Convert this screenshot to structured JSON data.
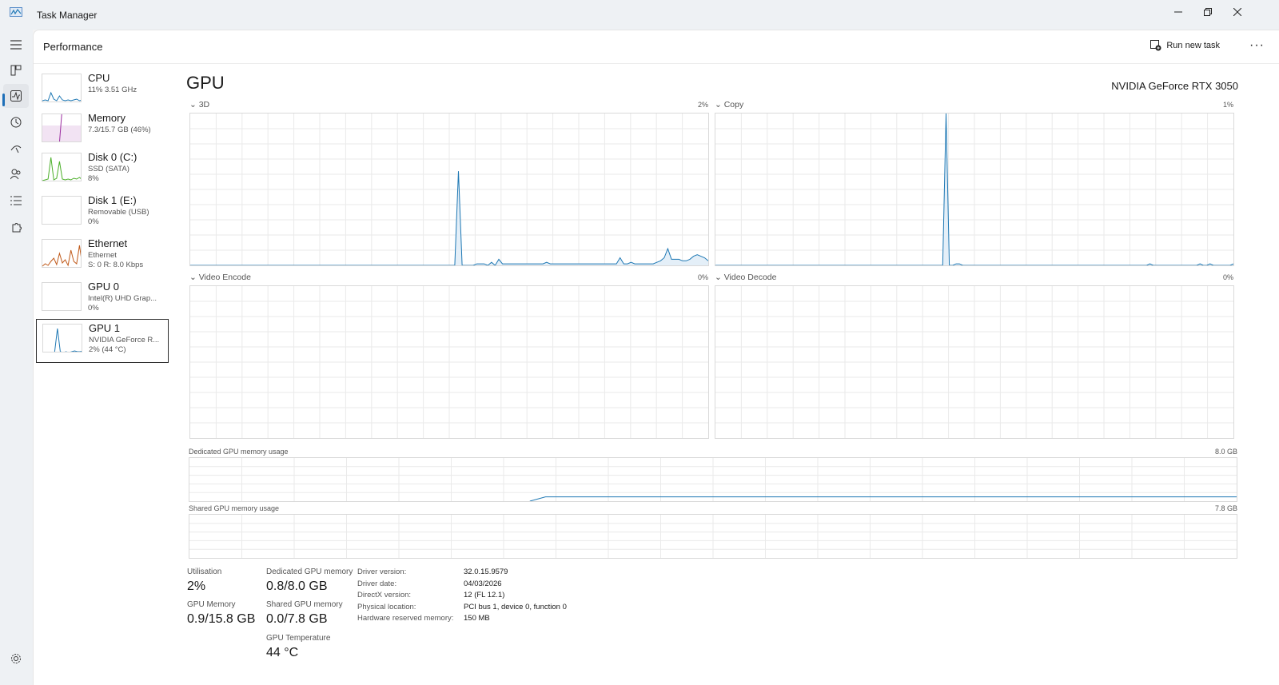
{
  "window": {
    "title": "Task Manager"
  },
  "header": {
    "page_title": "Performance",
    "run_new_task": "Run new task"
  },
  "sidebar": [
    {
      "name": "CPU",
      "sub1": "11%  3.51 GHz",
      "sub2": "",
      "color": "#1e78b4"
    },
    {
      "name": "Memory",
      "sub1": "7.3/15.7 GB (46%)",
      "sub2": "",
      "color": "#9b2da0"
    },
    {
      "name": "Disk 0 (C:)",
      "sub1": "SSD (SATA)",
      "sub2": "8%",
      "color": "#4caf2a"
    },
    {
      "name": "Disk 1 (E:)",
      "sub1": "Removable (USB)",
      "sub2": "0%",
      "color": "#4caf2a"
    },
    {
      "name": "Ethernet",
      "sub1": "Ethernet",
      "sub2": "S: 0  R: 8.0 Kbps",
      "color": "#c05a1a"
    },
    {
      "name": "GPU 0",
      "sub1": "Intel(R) UHD Grap...",
      "sub2": "0%",
      "color": "#1e78b4"
    },
    {
      "name": "GPU 1",
      "sub1": "NVIDIA GeForce R...",
      "sub2": "2% (44 °C)",
      "color": "#1e78b4"
    }
  ],
  "gpu": {
    "heading": "GPU",
    "model": "NVIDIA GeForce RTX 3050",
    "engines": [
      {
        "label": "3D",
        "value": "2%",
        "series": [
          0,
          0,
          0,
          0,
          0,
          0,
          0,
          0,
          0,
          0,
          0,
          0,
          0,
          0,
          0,
          0,
          0,
          0,
          0,
          0,
          0,
          0,
          0,
          0,
          0,
          0,
          0,
          0,
          0,
          0,
          0,
          0,
          0,
          0,
          0,
          0,
          0,
          0,
          0,
          0,
          0,
          0,
          0,
          0,
          0,
          0,
          0,
          0,
          0,
          0,
          0,
          0,
          0,
          0,
          0,
          0,
          0,
          0,
          0,
          0,
          0,
          0,
          0,
          0,
          0,
          0,
          0,
          0,
          0,
          0,
          0,
          0,
          0,
          62,
          0,
          0,
          0,
          0,
          1,
          1,
          1,
          0,
          2,
          0,
          4,
          1,
          1,
          1,
          1,
          1,
          1,
          1,
          1,
          1,
          1,
          1,
          1,
          2,
          1,
          1,
          1,
          1,
          1,
          1,
          1,
          1,
          1,
          1,
          1,
          1,
          1,
          1,
          1,
          1,
          1,
          1,
          1,
          5,
          1,
          1,
          2,
          1,
          1,
          1,
          1,
          1,
          1,
          2,
          3,
          5,
          11,
          4,
          4,
          4,
          3,
          3,
          4,
          6,
          7,
          6,
          5,
          3
        ]
      },
      {
        "label": "Copy",
        "value": "1%",
        "series": [
          0,
          0,
          0,
          0,
          0,
          0,
          0,
          0,
          0,
          0,
          0,
          0,
          0,
          0,
          0,
          0,
          0,
          0,
          0,
          0,
          0,
          0,
          0,
          0,
          0,
          0,
          0,
          0,
          0,
          0,
          0,
          0,
          0,
          0,
          0,
          0,
          0,
          0,
          0,
          0,
          0,
          0,
          0,
          0,
          0,
          0,
          0,
          0,
          0,
          0,
          0,
          0,
          0,
          0,
          0,
          0,
          0,
          0,
          0,
          0,
          0,
          0,
          0,
          0,
          0,
          0,
          0,
          0,
          0,
          100,
          0,
          0,
          1,
          1,
          0,
          0,
          0,
          0,
          0,
          0,
          0,
          0,
          0,
          0,
          0,
          0,
          0,
          0,
          0,
          0,
          0,
          0,
          0,
          0,
          0,
          0,
          0,
          0,
          0,
          0,
          0,
          0,
          0,
          0,
          0,
          0,
          0,
          0,
          0,
          0,
          0,
          0,
          0,
          0,
          0,
          0,
          0,
          0,
          0,
          0,
          0,
          0,
          0,
          0,
          0,
          0,
          0,
          0,
          0,
          0,
          1,
          0,
          0,
          0,
          0,
          0,
          0,
          0,
          0,
          0,
          0,
          0,
          0,
          0,
          0,
          1,
          0,
          0,
          1,
          0,
          0,
          0,
          0,
          0,
          0,
          1
        ]
      },
      {
        "label": "Video Encode",
        "value": "0%",
        "series": []
      },
      {
        "label": "Video Decode",
        "value": "0%",
        "series": []
      }
    ],
    "dedicated_mem": {
      "label": "Dedicated GPU memory usage",
      "max": "8.0 GB",
      "fraction": 0.1
    },
    "shared_mem": {
      "label": "Shared GPU memory usage",
      "max": "7.8 GB",
      "fraction": 0.0
    },
    "stats": {
      "utilisation_label": "Utilisation",
      "utilisation": "2%",
      "gpu_memory_label": "GPU Memory",
      "gpu_memory": "0.9/15.8 GB",
      "dedicated_label": "Dedicated GPU memory",
      "dedicated": "0.8/8.0 GB",
      "shared_label": "Shared GPU memory",
      "shared": "0.0/7.8 GB",
      "temp_label": "GPU Temperature",
      "temp": "44 °C"
    },
    "info": [
      {
        "label": "Driver version:",
        "value": "32.0.15.9579"
      },
      {
        "label": "Driver date:",
        "value": "04/03/2026"
      },
      {
        "label": "DirectX version:",
        "value": "12 (FL 12.1)"
      },
      {
        "label": "Physical location:",
        "value": "PCI bus 1, device 0, function 0"
      },
      {
        "label": "Hardware reserved memory:",
        "value": "150 MB"
      }
    ]
  },
  "colors": {
    "accent": "#1e78b4",
    "graph_fill": "#e4eff8",
    "grid": "#eaeaea"
  }
}
